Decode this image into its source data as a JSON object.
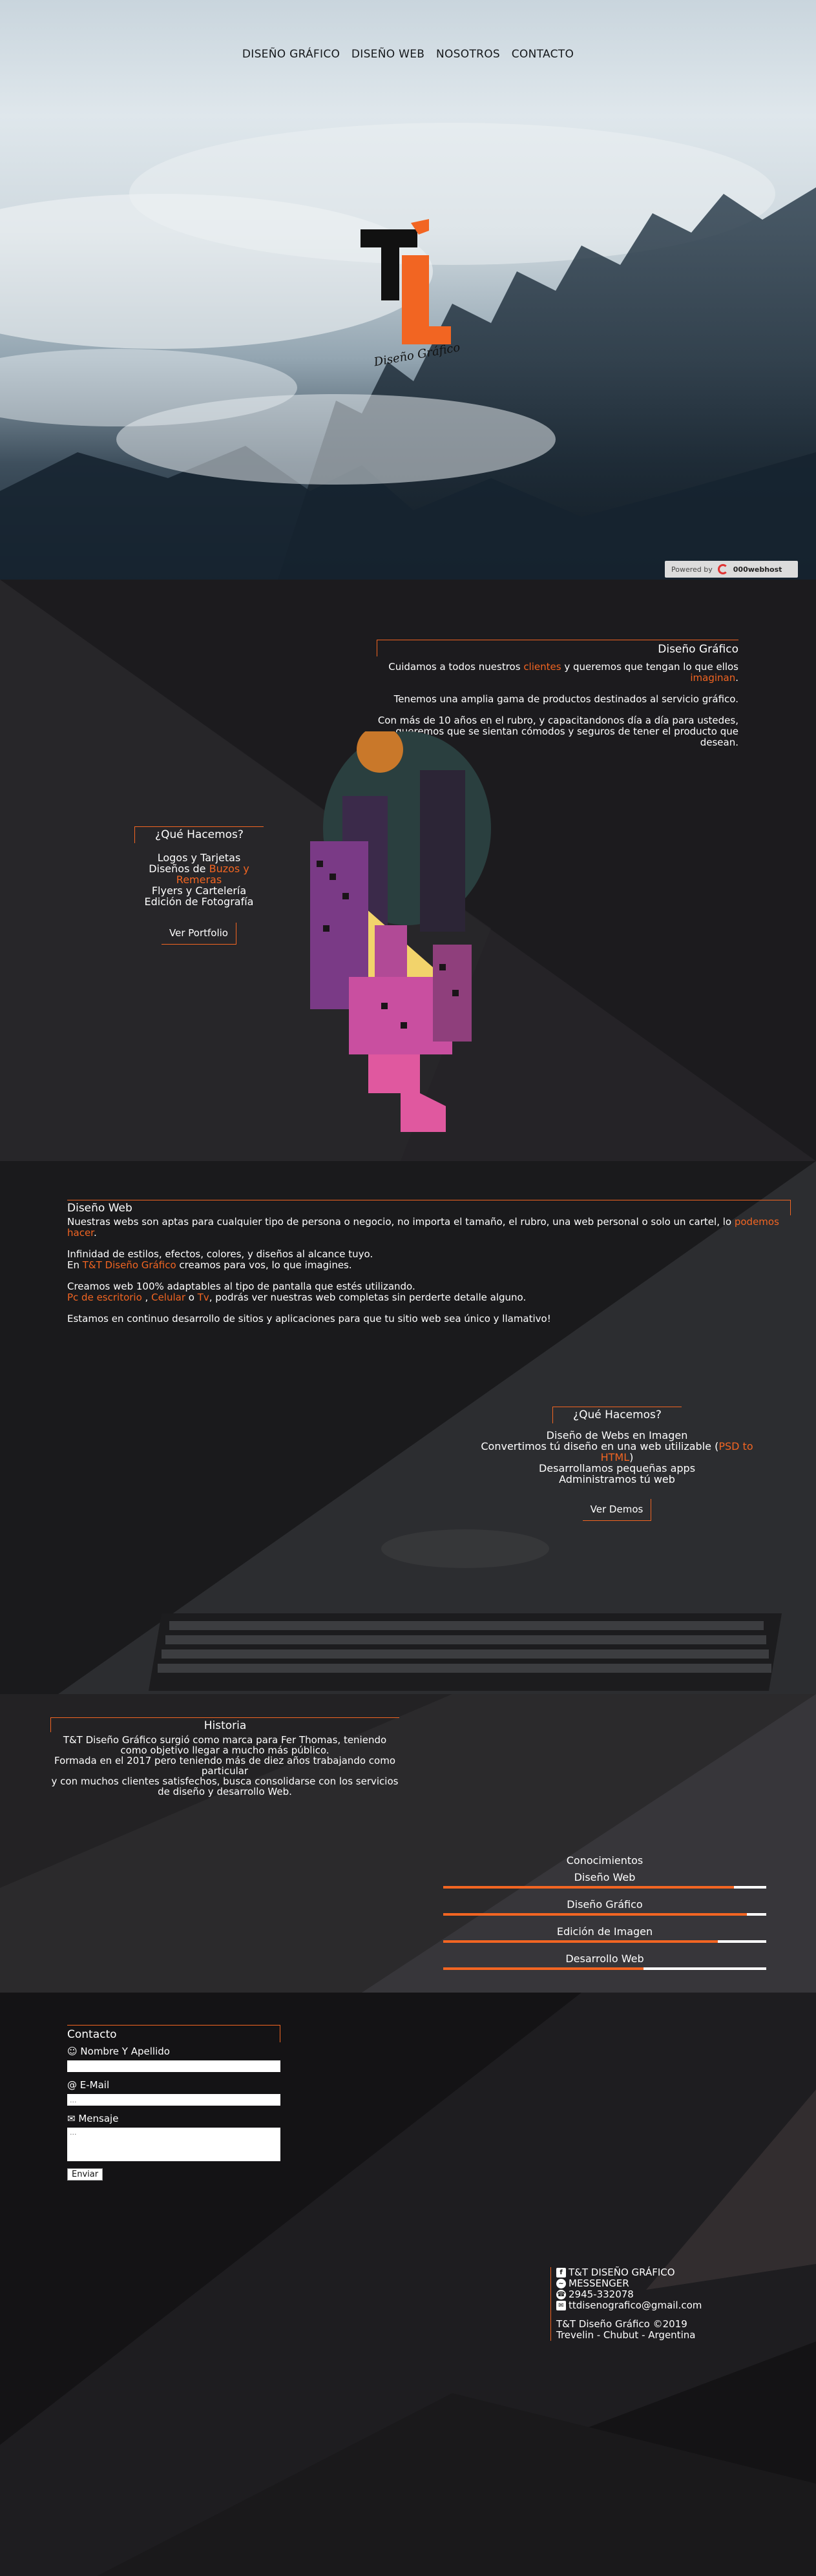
{
  "nav": {
    "items": [
      "DISEÑO GRÁFICO",
      "DISEÑO WEB",
      "NOSOTROS",
      "CONTACTO"
    ]
  },
  "hero": {
    "logo_text": "Diseño Gráfico",
    "powered_prefix": "Powered by",
    "powered_brand": "000webhost"
  },
  "grafico": {
    "title": "Diseño Gráfico",
    "p1_a": "Cuidamos a todos nuestros ",
    "p1_highlight": "clientes",
    "p1_b": " y queremos que tengan lo que ellos ",
    "p1_highlight2": "imaginan",
    "p1_c": ".",
    "p2": "Tenemos una amplia gama de productos destinados al servicio gráfico.",
    "p3": "Con más de 10 años en el rubro, y capacitandonos día a día para ustedes, queremos que se sientan cómodos y seguros de tener el producto que desean.",
    "que_title": "¿Qué Hacemos?",
    "que_1": "Logos y Tarjetas",
    "que_2a": "Diseños de ",
    "que_2b": "Buzos y Remeras",
    "que_3": "Flyers y Cartelería",
    "que_4": "Edición de Fotografía",
    "button": "Ver Portfolio"
  },
  "web": {
    "title": "Diseño Web",
    "p1_a": "Nuestras webs son aptas para cualquier tipo de persona o negocio, no importa el tamaño, el rubro, una web personal o solo un cartel, lo ",
    "p1_highlight": "podemos hacer",
    "p1_b": ".",
    "p2_line1": "Infinidad de estilos, efectos, colores, y diseños al alcance tuyo.",
    "p2_line2_a": "En ",
    "p2_line2_highlight": "T&T Diseño Gráfico",
    "p2_line2_b": " creamos para vos, lo que imagines.",
    "p3_line1": "Creamos web 100% adaptables al tipo de pantalla que estés utilizando.",
    "p3_h1": "Pc de escritorio",
    "p3_sep1": " , ",
    "p3_h2": "Celular",
    "p3_sep2": " o ",
    "p3_h3": "Tv",
    "p3_rest": ", podrás ver nuestras web completas sin perderte detalle alguno.",
    "p4": "Estamos en continuo desarrollo de sitios y aplicaciones para que tu sitio web sea único y llamativo!",
    "que_title": "¿Qué Hacemos?",
    "que_1": "Diseño de Webs en Imagen",
    "que_2a": "Convertimos tú diseño en una web utilizable (",
    "que_2b": "PSD to HTML",
    "que_2c": ")",
    "que_3": "Desarrollamos pequeñas apps",
    "que_4": "Administramos tú web",
    "button": "Ver Demos"
  },
  "historia": {
    "title": "Historia",
    "text1": "T&T Diseño Gráfico surgió como marca para Fer Thomas, teniendo como objetivo llegar a mucho más público.",
    "text2": "Formada en el 2017 pero teniendo más de diez años trabajando como particular",
    "text3": "y con muchos clientes satisfechos, busca consolidarse con los servicios de diseño y desarrollo Web."
  },
  "skills": {
    "title": "Conocimientos",
    "items": [
      {
        "label": "Diseño Web",
        "level": 0.9
      },
      {
        "label": "Diseño Gráfico",
        "level": 0.94
      },
      {
        "label": "Edición de Imagen",
        "level": 0.85
      },
      {
        "label": "Desarrollo Web",
        "level": 0.62
      }
    ]
  },
  "contacto": {
    "title": "Contacto",
    "name_label": "Nombre Y Apellido",
    "email_label": "E-Mail",
    "email_placeholder": "...",
    "msg_label": "Mensaje",
    "msg_placeholder": "...",
    "submit": "Enviar"
  },
  "footer": {
    "facebook": "T&T DISEÑO GRÁFICO",
    "messenger": "MESSENGER",
    "whatsapp": "2945-332078",
    "email": "ttdisenografico@gmail.com",
    "copy": "T&T Diseño Gráfico ©2019",
    "location": "Trevelin - Chubut - Argentina"
  },
  "colors": {
    "accent": "#f26522",
    "dark": "#1e1d20"
  },
  "icons": [
    "facebook-icon",
    "messenger-icon",
    "whatsapp-icon",
    "mail-icon",
    "user-icon",
    "at-icon",
    "comment-icon"
  ]
}
